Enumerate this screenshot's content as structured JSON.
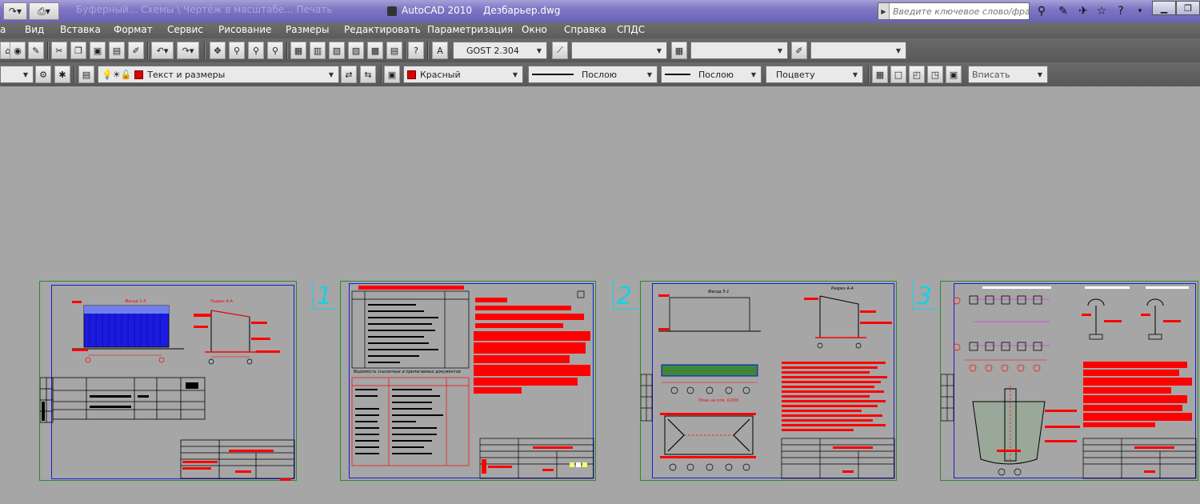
{
  "window": {
    "app_name": "AutoCAD 2010",
    "file_name": "Дезбарьер.dwg",
    "dim_title": "Буферный... Схемы \\ Чертёж в масштабе... Печать"
  },
  "search": {
    "placeholder": "Введите ключевое слово/фразу"
  },
  "menu": {
    "items": [
      "а",
      "Вид",
      "Вставка",
      "Формат",
      "Сервис",
      "Рисование",
      "Размеры",
      "Редактировать",
      "Параметризация",
      "Окно",
      "Справка",
      "СПДС"
    ]
  },
  "toolbar1": {
    "text_style": "GOST 2.304",
    "dim_style": "",
    "table_style": "",
    "multileader_style": ""
  },
  "toolbar2": {
    "layer_name": "Текст и размеры",
    "color": "Красный",
    "color_hex": "#e00000",
    "linetype": "Послою",
    "lineweight": "Послою",
    "plot_style": "Поцвету",
    "fit": "Вписать"
  },
  "sheets": [
    {
      "label": ""
    },
    {
      "label": "1"
    },
    {
      "label": "2"
    },
    {
      "label": "3"
    }
  ],
  "drawing_text": {
    "s1_title": "Фасад 1-5",
    "s1_section": "Разрез A-A",
    "s2_caption": "Ведомость ссылочных и прилагаемых документов",
    "s3_title": "Фасад 5-1",
    "s3_section": "Разрез A-A",
    "s3_plan": "План на отм. 0,000"
  },
  "colors": {
    "drawing_red": "#ff0000",
    "frame_blue": "#1a1ad8",
    "sheet_border_green": "#2a8a2a",
    "sheet_number_cyan": "#15d0e8",
    "menu_bg": "#5f5f5f",
    "workspace_bg": "#a6a6a6"
  },
  "icons": [
    "redo-icon",
    "print-icon",
    "binoculars-icon",
    "wrench-icon",
    "satellite-icon",
    "star-icon",
    "help-icon"
  ]
}
